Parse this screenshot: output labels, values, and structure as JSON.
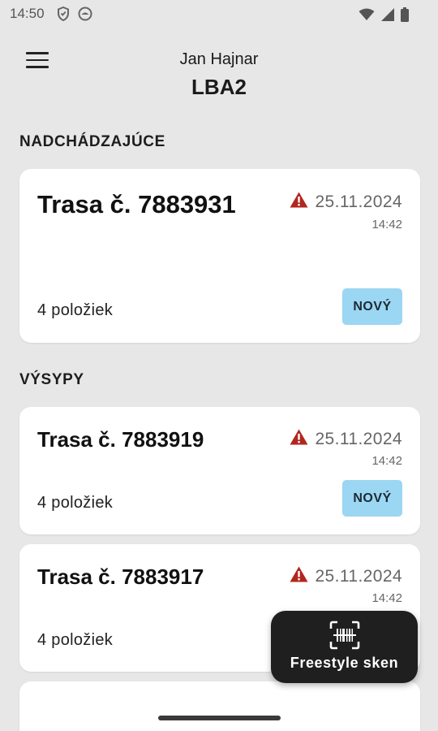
{
  "status_bar": {
    "time": "14:50",
    "icons": [
      "vpn-shield-icon",
      "circle-app-icon",
      "wifi-icon",
      "signal-icon",
      "battery-icon"
    ]
  },
  "header": {
    "user_name": "Jan Hajnar",
    "location": "LBA2",
    "menu_icon": "hamburger-menu-icon"
  },
  "sections": {
    "upcoming": {
      "title": "NADCHÁDZAJÚCE"
    },
    "dumps": {
      "title": "VÝSYPY"
    }
  },
  "cards": [
    {
      "title": "Trasa č. 7883931",
      "date": "25.11.2024",
      "time": "14:42",
      "count": "4 položiek",
      "badge": "NOVÝ",
      "warning": true
    },
    {
      "title": "Trasa č. 7883919",
      "date": "25.11.2024",
      "time": "14:42",
      "count": "4 položiek",
      "badge": "NOVÝ",
      "warning": true
    },
    {
      "title": "Trasa č. 7883917",
      "date": "25.11.2024",
      "time": "14:42",
      "count": "4 položiek",
      "badge": "",
      "warning": true
    }
  ],
  "fab": {
    "label": "Freestyle sken",
    "icon": "barcode-scan-icon"
  },
  "colors": {
    "background": "#e7e7e7",
    "card": "#ffffff",
    "badge": "#9bd6f2",
    "warning": "#b3261e",
    "fab": "#1f1f1f"
  }
}
